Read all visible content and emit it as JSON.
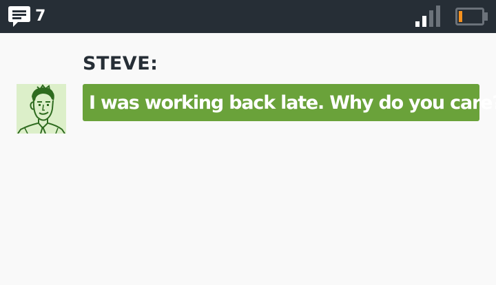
{
  "status_bar": {
    "message_icon": "chat-bubble-icon",
    "message_count": "7",
    "signal_icon": "signal-strength-icon",
    "signal_level": 0.5,
    "battery_icon": "battery-icon",
    "battery_level": 0.15,
    "colors": {
      "background": "#262e36",
      "battery_fill": "#f5911e",
      "signal_active": "#ffffff",
      "signal_inactive": "#6b727a"
    }
  },
  "conversation": {
    "speaker": "STEVE:",
    "avatar_icon": "character-portrait-icon",
    "message": "I was working back late. Why do you care?",
    "colors": {
      "bubble": "#6aa23a",
      "avatar_bg": "#dcefc9",
      "speaker_text": "#262e36"
    }
  }
}
